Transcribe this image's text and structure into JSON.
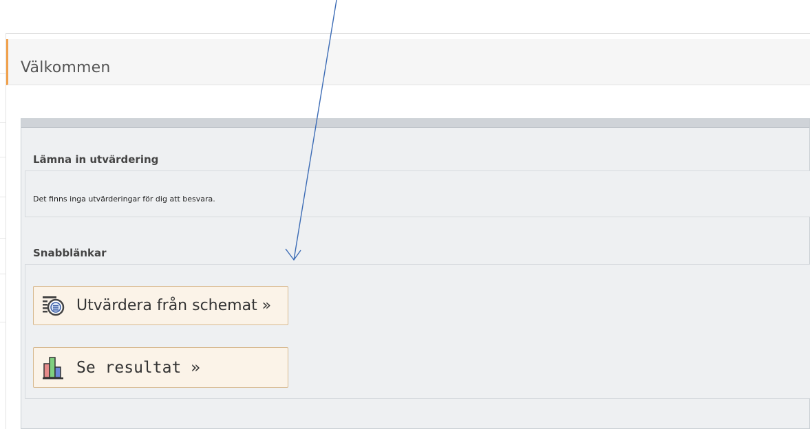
{
  "window": {
    "title": "Välkommen"
  },
  "evaluation_section": {
    "title": "Lämna in utvärdering",
    "message": "Det finns inga utvärderingar för dig att besvara."
  },
  "quicklinks_section": {
    "title": "Snabblänkar",
    "buttons": [
      {
        "label": "Utvärdera från schemat »",
        "icon": "schedule-evaluate-icon"
      },
      {
        "label": "Se resultat »",
        "icon": "bar-chart-icon"
      }
    ]
  },
  "colors": {
    "title_accent": "#f0a04b",
    "panel_bg": "#eef0f2",
    "button_bg": "#fbf3e8",
    "button_border": "#d7b88e",
    "annotation_arrow": "#3b6bb5"
  }
}
